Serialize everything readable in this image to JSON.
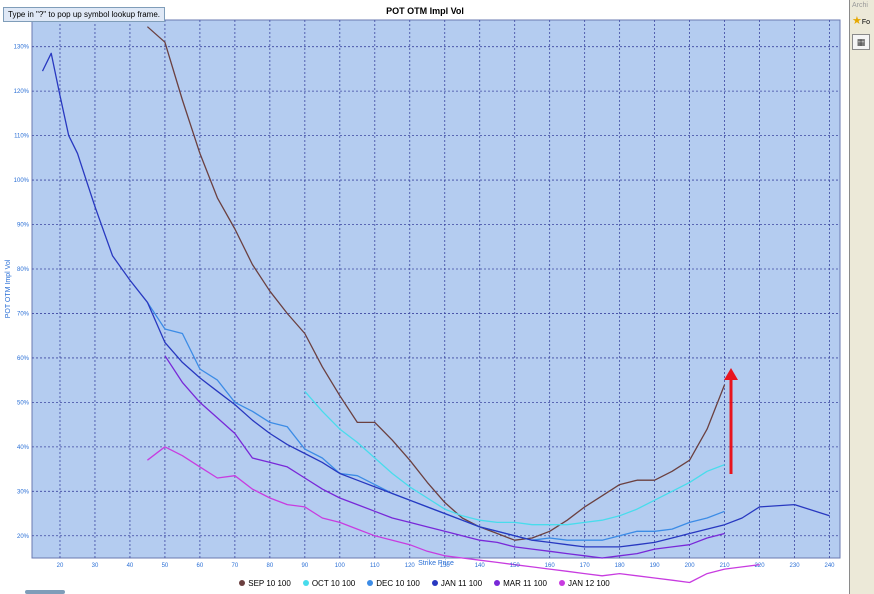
{
  "window": {
    "hint": "Type in \"?\" to pop up symbol lookup frame.",
    "side_label": "Archi",
    "side_star_text": "Fo"
  },
  "colors": {
    "plot_bg": "#b4ccf0",
    "grid": "#3c46a0",
    "axis_label": "#2a6fd6",
    "arrow": "#e8141e"
  },
  "icons": [
    "star-icon",
    "grid-view-icon"
  ],
  "chart_data": {
    "type": "line",
    "title": "POT OTM Impl Vol",
    "xlabel": "Strike Price",
    "ylabel": "POT OTM Impl Vol",
    "xlim": [
      12,
      243
    ],
    "ylim": [
      15,
      136
    ],
    "x_ticks": [
      20,
      30,
      40,
      50,
      60,
      70,
      80,
      90,
      100,
      110,
      120,
      130,
      140,
      150,
      160,
      170,
      180,
      190,
      200,
      210,
      220,
      230,
      240
    ],
    "y_ticks": [
      20,
      30,
      40,
      50,
      60,
      70,
      80,
      90,
      100,
      110,
      120,
      130
    ],
    "y_tick_labels": [
      "20%",
      "30%",
      "40%",
      "50%",
      "60%",
      "70%",
      "80%",
      "90%",
      "100%",
      "110%",
      "120%",
      "130%"
    ],
    "grid": true,
    "legend_position": "bottom",
    "series": [
      {
        "name": "SEP 10 100",
        "color": "#6b4040",
        "x": [
          45,
          50,
          55,
          60,
          65,
          70,
          75,
          80,
          85,
          90,
          95,
          100,
          105,
          110,
          115,
          120,
          125,
          130,
          135,
          140,
          145,
          150,
          155,
          160,
          165,
          170,
          175,
          180,
          185,
          190,
          195,
          200,
          205,
          210
        ],
        "y": [
          134.5,
          131,
          118,
          106,
          96,
          89,
          81,
          75,
          70,
          65.5,
          58,
          51.5,
          45.5,
          45.5,
          41.5,
          37,
          32,
          27.5,
          24,
          22,
          20.5,
          19,
          19.5,
          21,
          23.5,
          26.5,
          29,
          31.5,
          32.5,
          32.5,
          34.5,
          37,
          44,
          54
        ]
      },
      {
        "name": "OCT 10 100",
        "color": "#48dcec",
        "x": [
          90,
          95,
          100,
          105,
          110,
          115,
          120,
          125,
          130,
          135,
          140,
          145,
          150,
          155,
          160,
          165,
          170,
          175,
          180,
          185,
          190,
          195,
          200,
          205,
          210
        ],
        "y": [
          52.5,
          48,
          44,
          41,
          37.5,
          34,
          31,
          28.5,
          26,
          24.5,
          23.5,
          23,
          23,
          22.5,
          22.5,
          22.5,
          23,
          23.5,
          24.5,
          26,
          28,
          30,
          32,
          34.5,
          36
        ]
      },
      {
        "name": "DEC 10 100",
        "color": "#3c8ce6",
        "x": [
          45,
          50,
          55,
          60,
          65,
          70,
          75,
          80,
          85,
          90,
          95,
          100,
          105,
          110,
          115,
          120,
          125,
          130,
          135,
          140,
          145,
          150,
          155,
          160,
          165,
          170,
          175,
          180,
          185,
          190,
          195,
          200,
          205,
          210
        ],
        "y": [
          72.5,
          66.5,
          65.5,
          57.5,
          55,
          50,
          48,
          45.5,
          44.5,
          39.5,
          37.5,
          34,
          33.5,
          31.5,
          29.5,
          28,
          26.5,
          25,
          23.5,
          22,
          21,
          20,
          19,
          19.5,
          19,
          19,
          19,
          20,
          21,
          21,
          21.5,
          23,
          24,
          25.5
        ]
      },
      {
        "name": "JAN 11 100",
        "color": "#2838c0",
        "x": [
          15,
          17.5,
          20,
          22.5,
          25,
          27.5,
          30,
          32.5,
          35,
          40,
          45,
          50,
          55,
          60,
          65,
          70,
          75,
          80,
          85,
          90,
          95,
          100,
          105,
          110,
          115,
          120,
          125,
          130,
          135,
          140,
          145,
          150,
          155,
          160,
          165,
          170,
          175,
          180,
          185,
          190,
          195,
          200,
          205,
          210,
          215,
          220,
          230,
          240
        ],
        "y": [
          124.5,
          128.5,
          119,
          110,
          106,
          100,
          94,
          88.5,
          83,
          77.5,
          72.5,
          63.5,
          59,
          55.5,
          52.5,
          49.5,
          46,
          43,
          40.5,
          38.5,
          36.5,
          34,
          32.5,
          31,
          29.5,
          28,
          26.5,
          25,
          23.5,
          22,
          21,
          20,
          19,
          18.5,
          18,
          17.5,
          17.5,
          17.5,
          18,
          18.5,
          19.5,
          20.5,
          21.5,
          22.5,
          24,
          26.5,
          27,
          24.5
        ]
      },
      {
        "name": "MAR 11 100",
        "color": "#7828d8",
        "x": [
          50,
          55,
          60,
          65,
          70,
          75,
          80,
          85,
          90,
          95,
          100,
          105,
          110,
          115,
          120,
          125,
          130,
          135,
          140,
          145,
          150,
          155,
          160,
          165,
          170,
          175,
          180,
          185,
          190,
          195,
          200,
          205,
          210
        ],
        "y": [
          60.5,
          54.5,
          50,
          46.5,
          43,
          37.5,
          36.5,
          35.5,
          33,
          30.5,
          28.5,
          27,
          25.5,
          24,
          23,
          22,
          21,
          20,
          19,
          18.5,
          17.5,
          17,
          16.5,
          16,
          15.5,
          15,
          15.5,
          16,
          17,
          17.5,
          18,
          19.5,
          20.5
        ]
      },
      {
        "name": "JAN 12 100",
        "color": "#c83ce0",
        "x": [
          45,
          50,
          55,
          60,
          65,
          70,
          75,
          80,
          85,
          90,
          95,
          100,
          105,
          110,
          115,
          120,
          125,
          130,
          135,
          140,
          145,
          150,
          155,
          160,
          165,
          170,
          175,
          180,
          185,
          190,
          195,
          200,
          205,
          210,
          215,
          220
        ],
        "y": [
          37,
          40,
          38,
          35.5,
          33,
          33.5,
          30.5,
          28.5,
          27,
          26.5,
          24,
          23,
          21.5,
          20,
          19,
          18,
          16.5,
          15.5,
          15,
          14.5,
          14,
          13.5,
          13,
          12.5,
          12,
          11.5,
          11,
          11.5,
          11,
          10.5,
          10,
          9.5,
          11.5,
          12.5,
          13,
          13.5
        ]
      }
    ]
  }
}
